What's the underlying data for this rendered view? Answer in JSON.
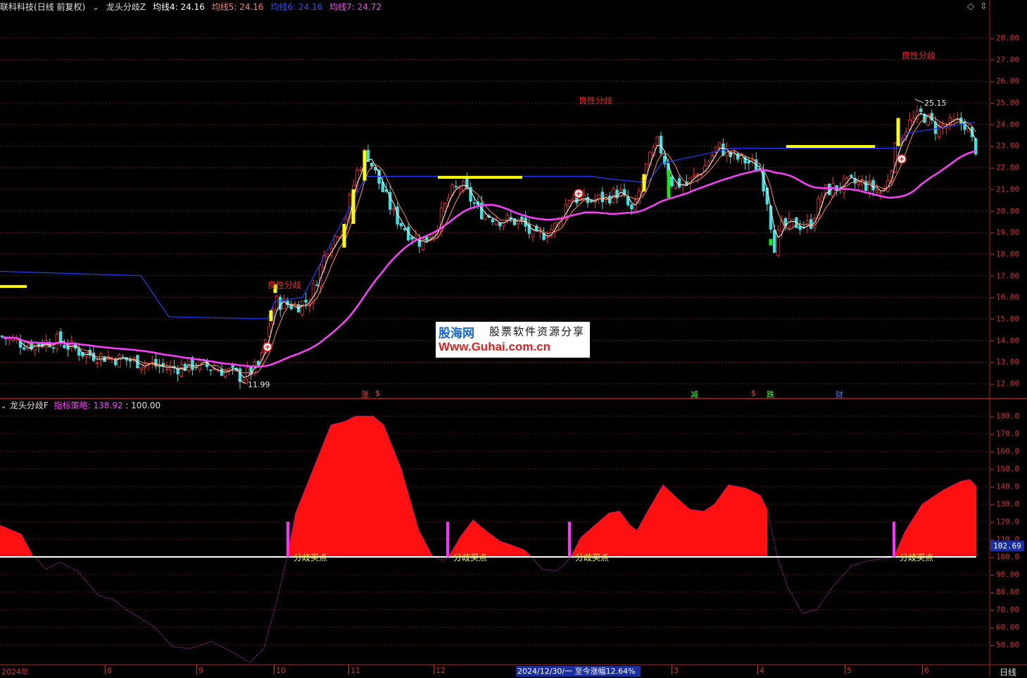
{
  "header": {
    "stock": "联科科技",
    "period": "(日线 前复权)",
    "indicator": "龙头分歧Z",
    "ma": [
      {
        "label": "均线4:",
        "value": "24.16",
        "color": "#ffffff"
      },
      {
        "label": "均线5:",
        "value": "24.16",
        "color": "#ff8080"
      },
      {
        "label": "均线6:",
        "value": "24.16",
        "color": "#3050ff"
      },
      {
        "label": "均线7:",
        "value": "24.72",
        "color": "#ff40ff"
      }
    ]
  },
  "sub_header": {
    "indicator": "龙头分歧F",
    "label": "指标策略:",
    "value1": "138.92",
    "value2": "100.00"
  },
  "main_axis": [
    "28.00",
    "27.00",
    "26.00",
    "25.00",
    "24.00",
    "23.00",
    "22.00",
    "21.00",
    "20.00",
    "19.00",
    "18.00",
    "17.00",
    "16.00",
    "15.00",
    "14.00",
    "13.00",
    "12.00"
  ],
  "sub_axis": [
    "180.0",
    "170.0",
    "160.0",
    "150.0",
    "140.0",
    "130.0",
    "120.0",
    "110.0",
    "100.0",
    "90.00",
    "80.00",
    "70.00",
    "60.00",
    "50.00"
  ],
  "sub_price_tag": "102.69",
  "xaxis": [
    {
      "label": "2024年"
    },
    {
      "label": "8"
    },
    {
      "label": "9"
    },
    {
      "label": "10"
    },
    {
      "label": "11"
    },
    {
      "label": "12"
    },
    {
      "label": "3"
    },
    {
      "label": "4"
    },
    {
      "label": "5"
    },
    {
      "label": "6"
    }
  ],
  "xaxis_right": "日线",
  "range_info": "2024/12/30/一  至今涨幅12.64%",
  "annotations": {
    "low": "11.99",
    "high": "25.15",
    "signal": "良性分歧",
    "buy": "分歧买点"
  },
  "event_marks": [
    {
      "label": "涨",
      "color": "#ff4040"
    },
    {
      "label": "$",
      "color": "#ff4040"
    },
    {
      "label": "减",
      "color": "#40ff40"
    },
    {
      "label": "$",
      "color": "#ff4040"
    },
    {
      "label": "跌",
      "color": "#40ff40"
    },
    {
      "label": "财",
      "color": "#4080ff"
    }
  ],
  "watermark": {
    "line1": "股海网",
    "line2": "股票软件资源分享",
    "line3": "Www.Guhai.com.cn"
  }
}
